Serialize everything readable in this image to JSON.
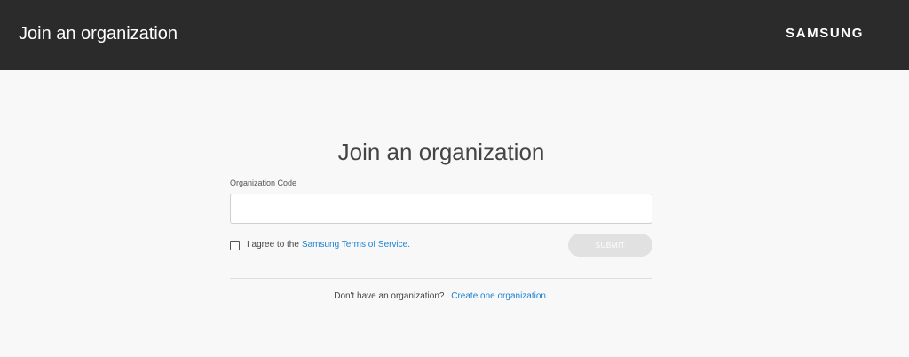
{
  "header": {
    "title": "Join an organization",
    "brand": "SAMSUNG"
  },
  "form": {
    "title": "Join an organization",
    "code_label": "Organization Code",
    "code_value": "",
    "code_placeholder": "",
    "agree_prefix": "I agree to the",
    "agree_link": "Samsung Terms of Service.",
    "agree_checked": false,
    "submit_label": "SUBMIT",
    "footer_text": "Don't have an organization?",
    "footer_link": "Create one organization."
  },
  "colors": {
    "header_bg": "#2b2b2b",
    "page_bg": "#f8f8f8",
    "link": "#1a82d4",
    "submit_disabled_bg": "#e1e1e1"
  }
}
